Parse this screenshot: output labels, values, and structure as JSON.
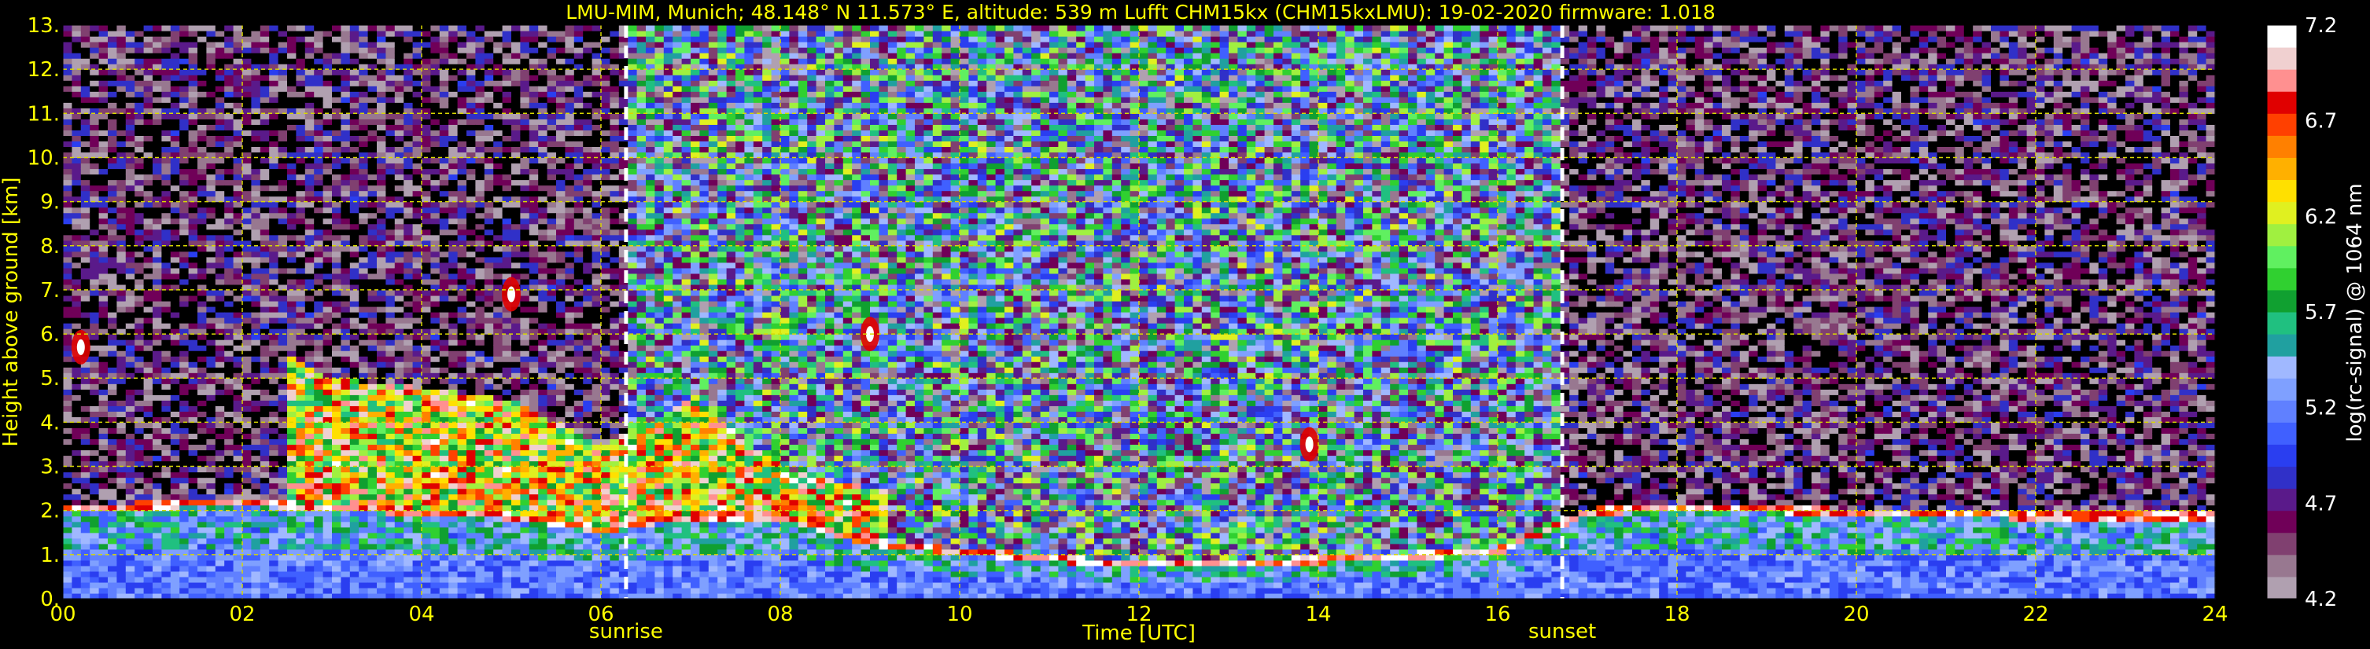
{
  "chart_data": {
    "type": "heatmap",
    "title": "LMU-MIM, Munich; 48.148° N 11.573° E, altitude: 539 m    Lufft CHM15kx (CHM15kxLMU): 19-02-2020    firmware: 1.018",
    "xlabel": "Time [UTC]",
    "ylabel": "Height above ground [km]",
    "xlim": [
      0,
      24
    ],
    "ylim": [
      0,
      13
    ],
    "x_ticks": [
      "00",
      "02",
      "04",
      "06",
      "08",
      "10",
      "12",
      "14",
      "16",
      "18",
      "20",
      "22",
      "24"
    ],
    "y_ticks": [
      "0.",
      "1.",
      "2.",
      "3.",
      "4.",
      "5.",
      "6.",
      "7.",
      "8.",
      "9.",
      "10.",
      "11.",
      "12.",
      "13."
    ],
    "grid": true,
    "colorbar": {
      "label": "log(rc-signal) @ 1064 nm",
      "range": [
        4.2,
        7.2
      ],
      "ticks": [
        "4.2",
        "4.7",
        "5.2",
        "5.7",
        "6.2",
        "6.7",
        "7.2"
      ],
      "colors": [
        "#b0a0b0",
        "#987890",
        "#804070",
        "#700058",
        "#5a1a8a",
        "#3030c8",
        "#2a3ef0",
        "#4060ff",
        "#6080ff",
        "#7fa0ff",
        "#a0b8ff",
        "#20a0a0",
        "#20c080",
        "#10a030",
        "#30d030",
        "#60f060",
        "#a0f040",
        "#e0f020",
        "#ffe000",
        "#ffb000",
        "#ff8000",
        "#ff4000",
        "#e00000",
        "#ff9090",
        "#f0d0d0",
        "#ffffff"
      ]
    },
    "events": [
      {
        "label": "sunrise",
        "x": 6.28
      },
      {
        "label": "sunset",
        "x": 16.72
      }
    ],
    "approx_features": [
      {
        "name": "boundary_layer_top_km",
        "x": [
          0,
          2,
          3,
          4,
          5,
          6,
          7,
          8,
          9,
          10,
          12,
          14,
          16,
          17,
          18,
          20,
          22,
          24
        ],
        "y": [
          2.0,
          2.1,
          2.0,
          1.9,
          1.8,
          1.5,
          1.8,
          1.8,
          1.2,
          1.0,
          0.7,
          0.8,
          1.0,
          1.9,
          2.0,
          1.9,
          1.8,
          1.8
        ]
      },
      {
        "name": "elevated_aerosol_layer_top_km",
        "x": [
          2.5,
          3,
          4,
          5,
          6,
          7,
          8,
          9
        ],
        "y": [
          5.5,
          5.0,
          4.8,
          4.5,
          3.5,
          4.5,
          3.0,
          2.5
        ]
      },
      {
        "name": "isolated_layers_km",
        "x": [
          0.2,
          5.0,
          9.0,
          13.9
        ],
        "y": [
          5.7,
          6.9,
          6.0,
          3.5
        ]
      }
    ]
  }
}
